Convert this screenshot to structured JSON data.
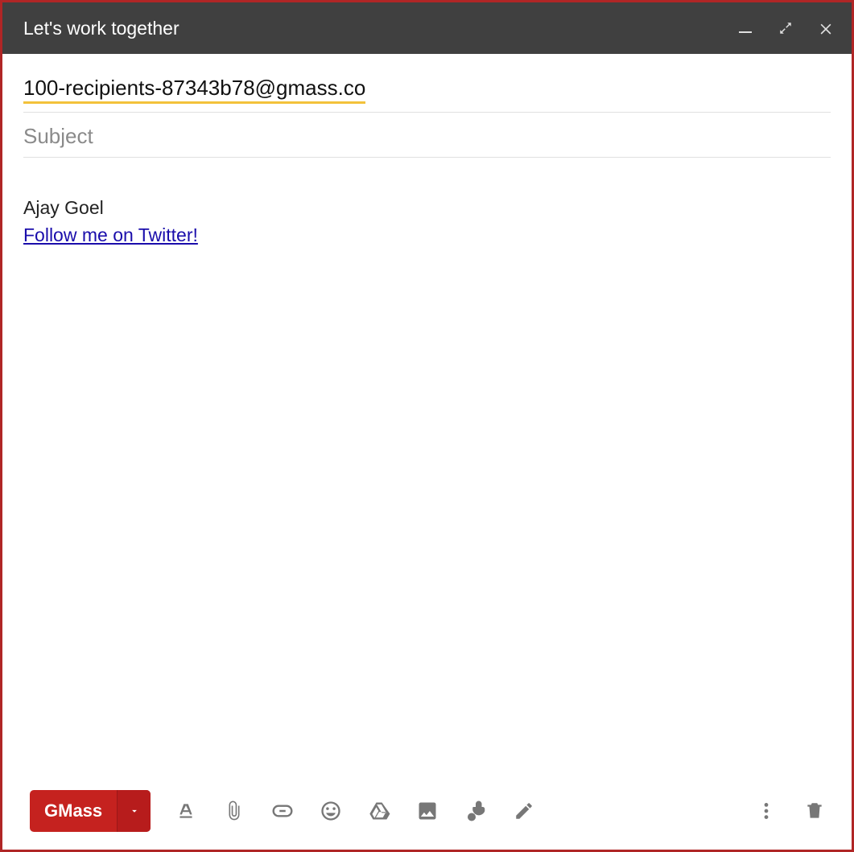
{
  "window": {
    "title": "Let's work together"
  },
  "fields": {
    "recipient": "100-recipients-87343b78@gmass.co",
    "subject_placeholder": "Subject",
    "subject_value": ""
  },
  "body": {
    "signature_name": "Ajay Goel",
    "signature_link": "Follow me on Twitter!"
  },
  "toolbar": {
    "send_label": "GMass"
  },
  "icons": {
    "minimize": "minimize-icon",
    "fullscreen": "fullscreen-icon",
    "close": "close-icon",
    "format": "format-text-icon",
    "attach": "paperclip-icon",
    "link": "link-icon",
    "emoji": "emoji-icon",
    "drive": "drive-icon",
    "image": "image-icon",
    "confidential": "lock-clock-icon",
    "pen": "pen-icon",
    "more": "more-vertical-icon",
    "trash": "trash-icon"
  },
  "colors": {
    "frame_border": "#b02626",
    "titlebar_bg": "#404040",
    "gmass_red": "#c5221f",
    "recipient_underline": "#f3c23b",
    "link_blue": "#1a0dab"
  }
}
